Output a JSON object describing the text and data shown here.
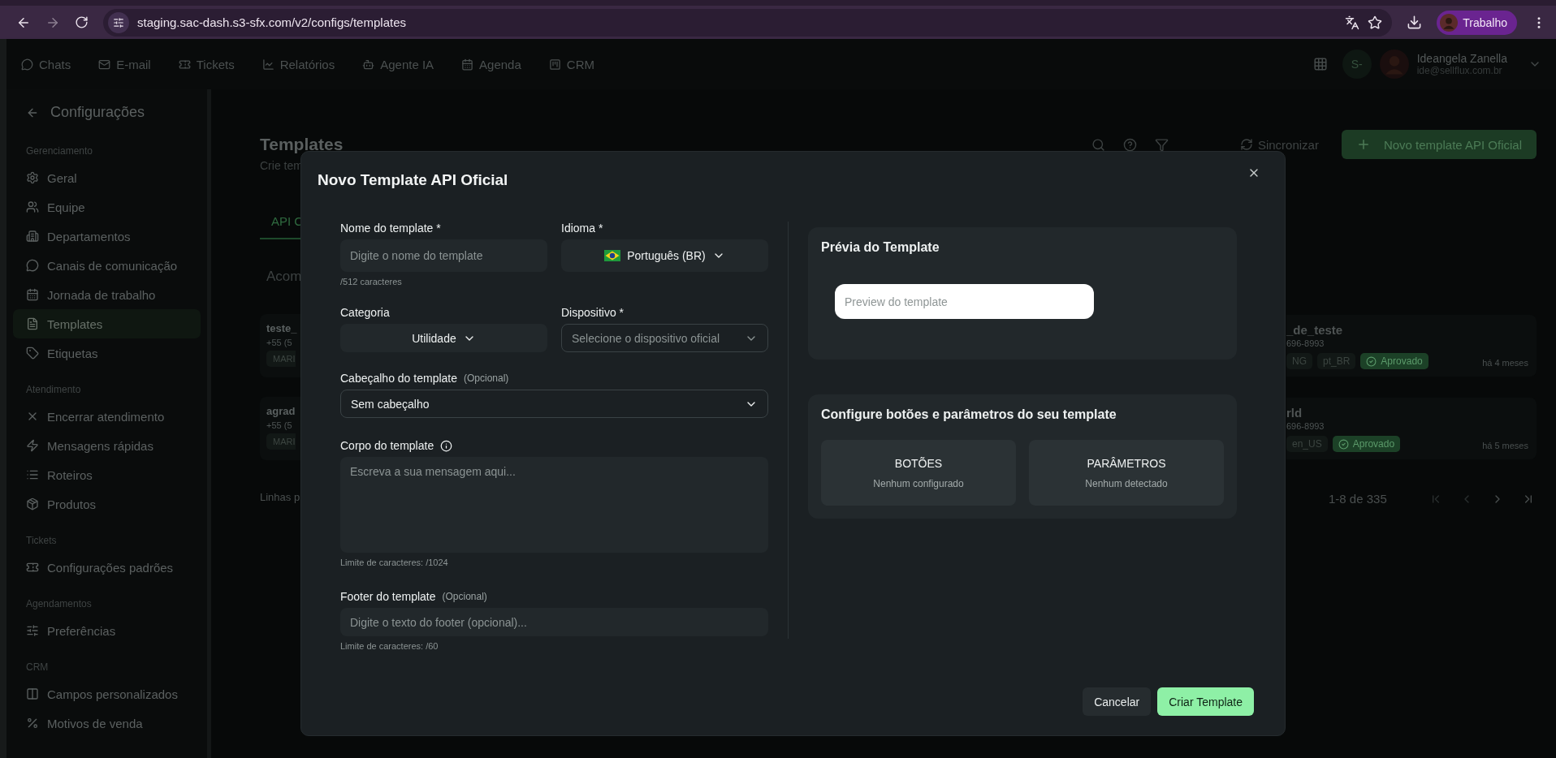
{
  "browser": {
    "url": "staging.sac-dash.s3-sfx.com/v2/configs/templates",
    "profile": "Trabalho"
  },
  "top_nav": {
    "items": [
      {
        "label": "Chats"
      },
      {
        "label": "E-mail"
      },
      {
        "label": "Tickets"
      },
      {
        "label": "Relatórios"
      },
      {
        "label": "Agente IA"
      },
      {
        "label": "Agenda"
      },
      {
        "label": "CRM"
      }
    ],
    "user": {
      "initials": "S-",
      "name": "Ideangela Zanella",
      "email": "ide@sellflux.com.br"
    }
  },
  "sidebar": {
    "title": "Configurações",
    "sections": [
      {
        "heading": "Gerenciamento",
        "items": [
          {
            "label": "Geral",
            "selected": false
          },
          {
            "label": "Equipe",
            "selected": false
          },
          {
            "label": "Departamentos",
            "selected": false
          },
          {
            "label": "Canais de comunicação",
            "selected": false
          },
          {
            "label": "Jornada de trabalho",
            "selected": false
          },
          {
            "label": "Templates",
            "selected": true
          },
          {
            "label": "Etiquetas",
            "selected": false
          }
        ]
      },
      {
        "heading": "Atendimento",
        "items": [
          {
            "label": "Encerrar atendimento",
            "selected": false
          },
          {
            "label": "Mensagens rápidas",
            "selected": false
          },
          {
            "label": "Roteiros",
            "selected": false
          },
          {
            "label": "Produtos",
            "selected": false
          }
        ]
      },
      {
        "heading": "Tickets",
        "items": [
          {
            "label": "Configurações padrões",
            "selected": false
          }
        ]
      },
      {
        "heading": "Agendamentos",
        "items": [
          {
            "label": "Preferências",
            "selected": false
          }
        ]
      },
      {
        "heading": "CRM",
        "items": [
          {
            "label": "Campos personalizados",
            "selected": false
          },
          {
            "label": "Motivos de venda",
            "selected": false
          }
        ]
      }
    ]
  },
  "page": {
    "title": "Templates",
    "subtitle": "Crie tem",
    "sync": "Sincronizar",
    "new_button": "Novo template API Oficial",
    "tabs": [
      {
        "label": "API C",
        "selected": true
      }
    ],
    "filter": "Acom",
    "cards_left": [
      {
        "title": "teste_",
        "phone": "+55 (5",
        "tag": "MARI"
      },
      {
        "title": "agrad",
        "phone": "+55 (5",
        "tag": "MARI"
      }
    ],
    "rows_label": "Linhas p",
    "cards_right": [
      {
        "title": "_de_teste",
        "phone": "696-8993",
        "tags": [
          "NG",
          "pt_BR"
        ],
        "status": "Aprovado",
        "time": "há 4 meses"
      },
      {
        "title": "rld",
        "phone": "696-8993",
        "tags": [
          "en_US"
        ],
        "status": "Aprovado",
        "time": "há 5 meses"
      }
    ],
    "pagination": "1-8 de 335"
  },
  "modal": {
    "title": "Novo Template API Oficial",
    "name_field": {
      "label": "Nome do template *",
      "placeholder": "Digite o nome do template",
      "hint": "/512 caracteres"
    },
    "language_field": {
      "label": "Idioma *",
      "value": "Português (BR)"
    },
    "category_field": {
      "label": "Categoria",
      "value": "Utilidade"
    },
    "device_field": {
      "label": "Dispositivo *",
      "placeholder": "Selecione o dispositivo oficial"
    },
    "header_field": {
      "label": "Cabeçalho do template",
      "note": "(Opcional)",
      "value": "Sem cabeçalho"
    },
    "body_field": {
      "label": "Corpo do template",
      "placeholder": "Escreva a sua mensagem aqui...",
      "hint": "Limite de caracteres: /1024"
    },
    "footer_field": {
      "label": "Footer do template",
      "note": "(Opcional)",
      "placeholder": "Digite o texto do footer (opcional)...",
      "hint": "Limite de caracteres: /60"
    },
    "preview": {
      "title": "Prévia do Template",
      "text": "Preview do template"
    },
    "config": {
      "title": "Configure botões e parâmetros do seu template",
      "tiles": [
        {
          "title": "BOTÕES",
          "status": "Nenhum configurado"
        },
        {
          "title": "PARÂMETROS",
          "status": "Nenhum detectado"
        }
      ]
    },
    "buttons": [
      {
        "label": "Cancelar",
        "kind": "secondary"
      },
      {
        "label": "Criar Template",
        "kind": "primary"
      }
    ]
  }
}
